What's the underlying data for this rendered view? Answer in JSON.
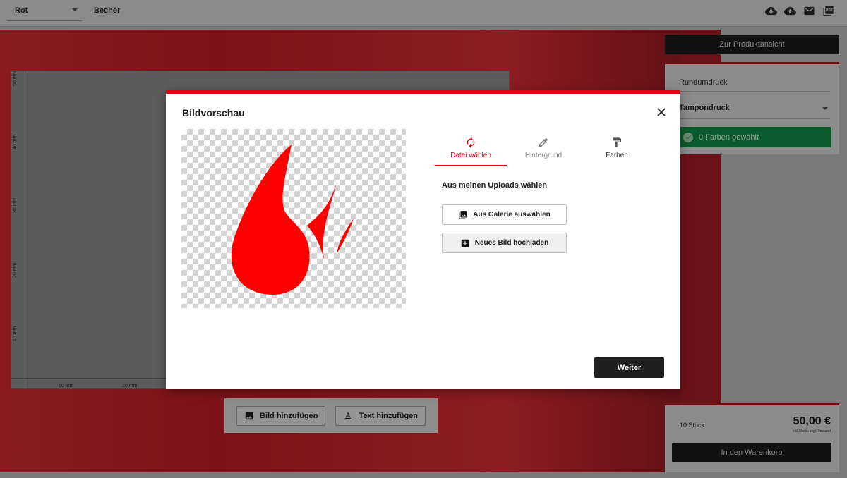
{
  "toolbar": {
    "color_value": "Rot",
    "product_name": "Becher",
    "icons": [
      "cloud-download-icon",
      "cloud-upload-icon",
      "mail-icon",
      "pdf-icon"
    ]
  },
  "canvas": {
    "ruler_vertical": [
      "50 mm",
      "40 mm",
      "30 mm",
      "20 mm",
      "10 mm"
    ],
    "ruler_horizontal": [
      "10 mm",
      "20 mm"
    ],
    "add_image_label": "Bild hinzufügen",
    "add_text_label": "Text hinzufügen"
  },
  "side_panel": {
    "product_view_label": "Zur Produktansicht",
    "print_type_label": "Rundumdruck",
    "print_method_value": "Tampondruck",
    "colors_status": "0 Farben gewählt",
    "quantity": "10 Stück",
    "price": "50,00 €",
    "price_note": "inkl.MwSt. zzgl. Versand",
    "cart_label": "In den Warenkorb"
  },
  "modal": {
    "title": "Bildvorschau",
    "tabs": [
      {
        "label": "Datei wählen",
        "icon": "refresh-icon",
        "active": true
      },
      {
        "label": "Hintergrund",
        "icon": "eyedropper-icon",
        "active": false
      },
      {
        "label": "Farben",
        "icon": "paint-roller-icon",
        "active": false
      }
    ],
    "uploads_heading": "Aus meinen Uploads wählen",
    "gallery_button": "Aus Galerie auswählen",
    "upload_button": "Neues Bild hochladen",
    "next_button": "Weiter",
    "preview_image": "red-flame-logo",
    "accent_color": "#e4000f"
  }
}
